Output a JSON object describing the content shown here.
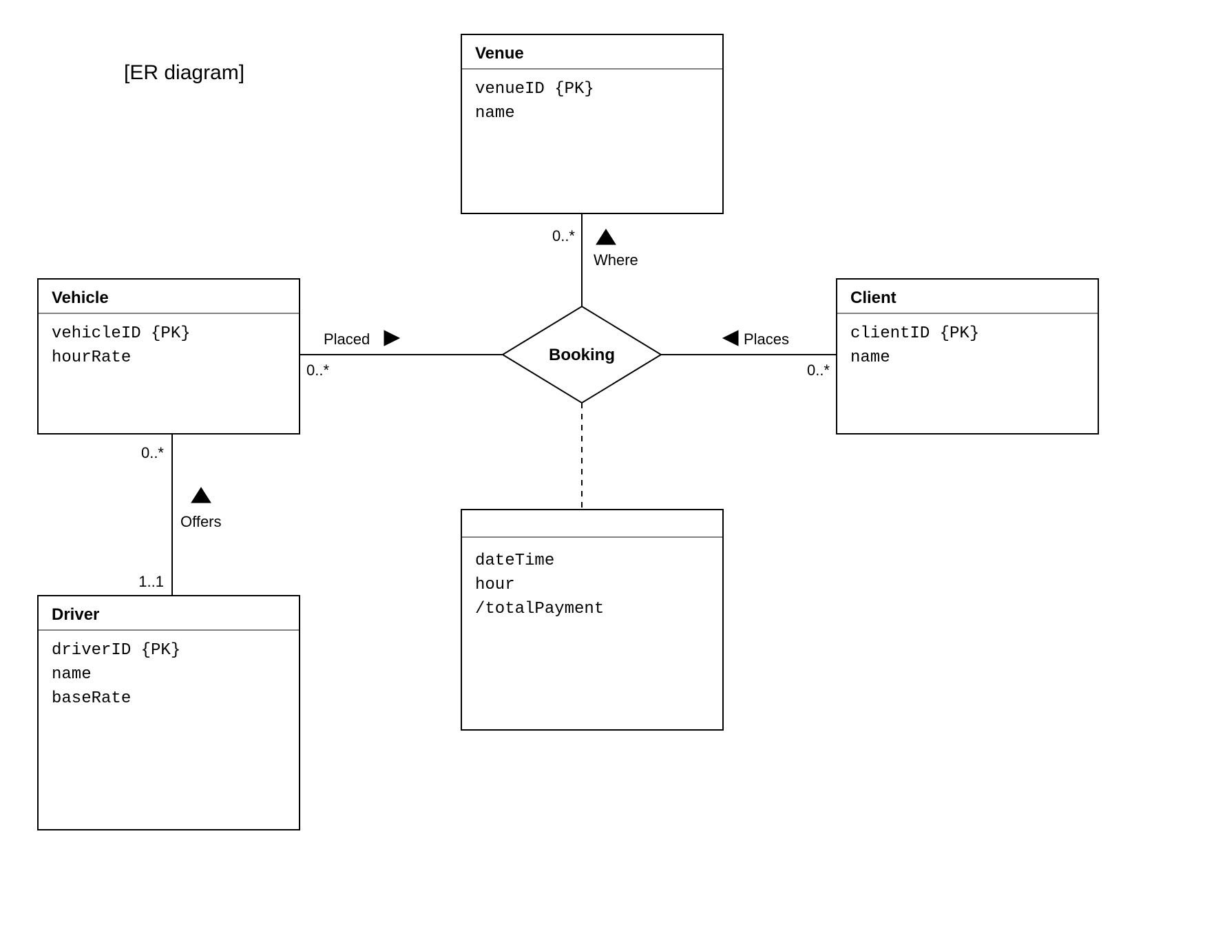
{
  "pageTitle": "[ER diagram]",
  "diamond": {
    "name": "Booking"
  },
  "entities": {
    "venue": {
      "name": "Venue",
      "attrs": [
        "venueID {PK}",
        "name"
      ]
    },
    "vehicle": {
      "name": "Vehicle",
      "attrs": [
        "vehicleID {PK}",
        "hourRate"
      ]
    },
    "client": {
      "name": "Client",
      "attrs": [
        "clientID {PK}",
        "name"
      ]
    },
    "driver": {
      "name": "Driver",
      "attrs": [
        "driverID {PK}",
        "name",
        "baseRate"
      ]
    },
    "assocClass": {
      "name": "",
      "attrs": [
        "dateTime",
        "hour",
        "/totalPayment"
      ]
    }
  },
  "relations": {
    "venue": {
      "label": "Where",
      "mult": "0..*"
    },
    "vehicle": {
      "label": "Placed",
      "mult": "0..*"
    },
    "client": {
      "label": "Places",
      "mult": "0..*"
    },
    "driver": {
      "label": "Offers",
      "multTop": "0..*",
      "multBottom": "1..1"
    }
  }
}
